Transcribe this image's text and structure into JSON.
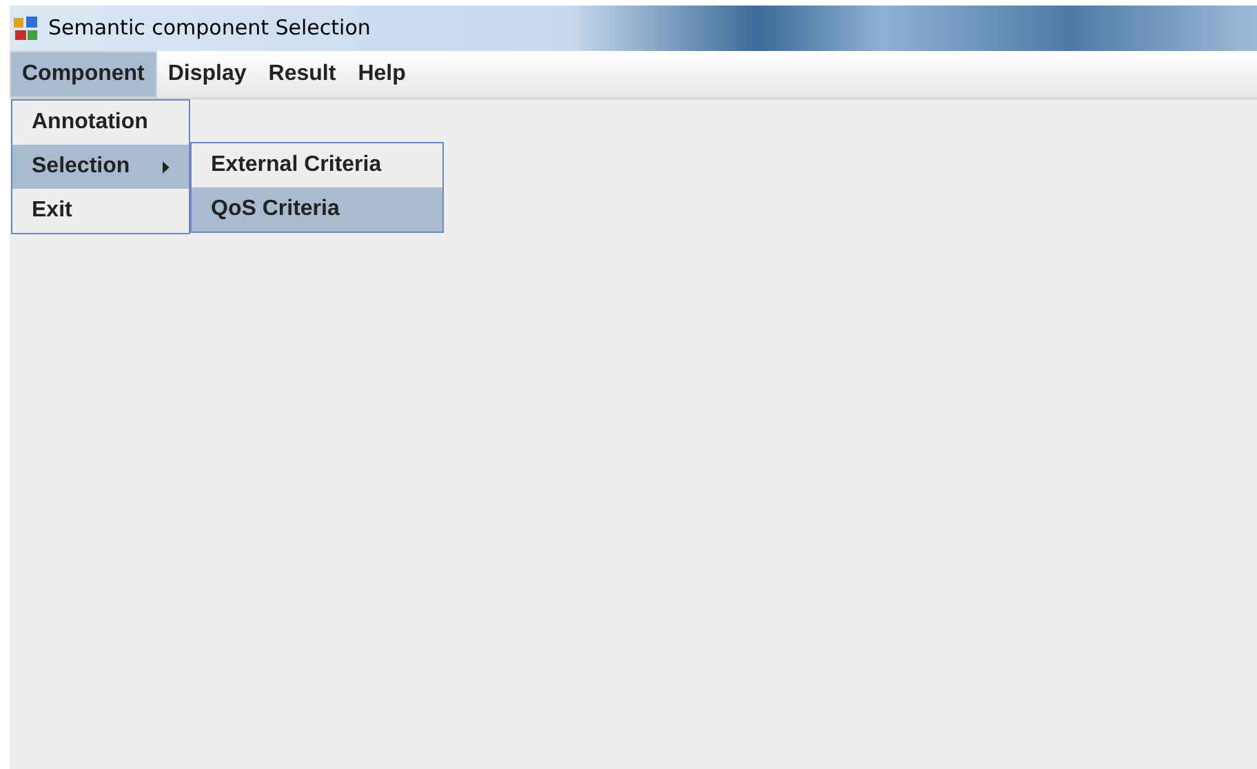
{
  "window": {
    "title": "Semantic component Selection"
  },
  "menu_bar": [
    {
      "label": "Component",
      "selected": true
    },
    {
      "label": "Display",
      "selected": false
    },
    {
      "label": "Result",
      "selected": false
    },
    {
      "label": "Help",
      "selected": false
    }
  ],
  "menu": [
    {
      "label": "Annotation",
      "selected": false,
      "has_submenu": false
    },
    {
      "label": "Selection",
      "selected": true,
      "has_submenu": true
    },
    {
      "label": "Exit",
      "selected": false,
      "has_submenu": false
    }
  ],
  "submenu": [
    {
      "label": "External Criteria",
      "selected": false
    },
    {
      "label": "QoS Criteria",
      "selected": true
    }
  ]
}
